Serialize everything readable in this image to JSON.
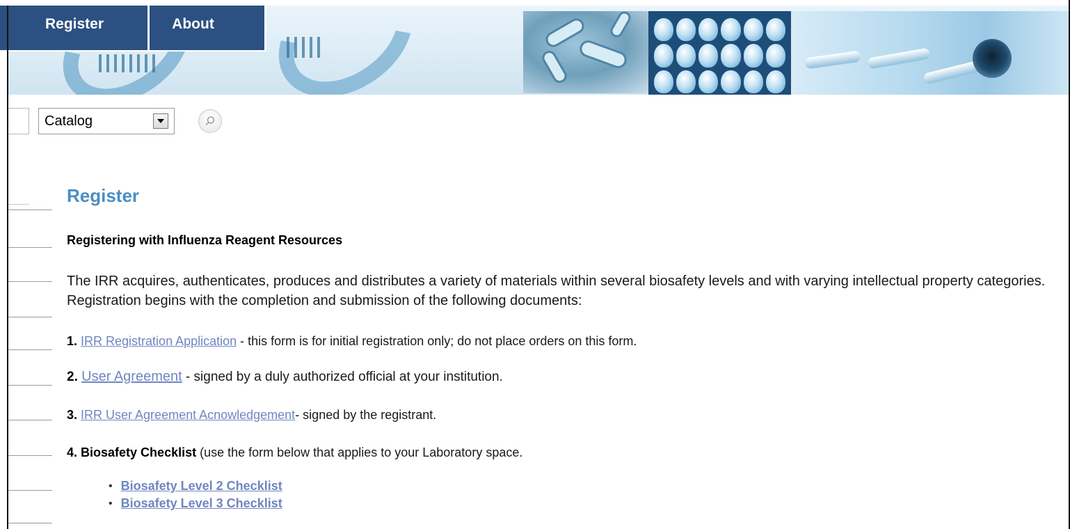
{
  "nav": {
    "tabs": [
      {
        "label": "Register"
      },
      {
        "label": "About"
      }
    ]
  },
  "search": {
    "input_value": "",
    "scope_selected": "Catalog"
  },
  "main": {
    "title": "Register",
    "subheading": "Registering with Influenza Reagent Resources",
    "intro": "The IRR acquires, authenticates, produces and distributes a variety of materials within several biosafety levels and with varying intellectual property categories.  Registration begins with the completion and submission of the following documents:",
    "steps": [
      {
        "num": "1.",
        "link": "IRR Registration Application",
        "text": " - this form is for initial registration only; do not place orders on this form."
      },
      {
        "num": "2.",
        "link": "User Agreement",
        "text": " - signed by a duly authorized official at your institution."
      },
      {
        "num": "3.",
        "link": "IRR User Agreement Acnowledgement",
        "text": "- signed by the registrant."
      },
      {
        "num": "4.",
        "label": "Biosafety Checklist",
        "text": " (use the form below that applies to your Laboratory space."
      }
    ],
    "checklists": [
      {
        "label": "Biosafety Level 2 Checklist"
      },
      {
        "label": "Biosafety Level 3 Checklist "
      }
    ]
  },
  "colors": {
    "nav_bg": "#2c5081",
    "title": "#4a8ec2",
    "link": "#6f86c0"
  },
  "icons": {
    "search": "search-icon",
    "dropdown": "chevron-down-icon"
  }
}
